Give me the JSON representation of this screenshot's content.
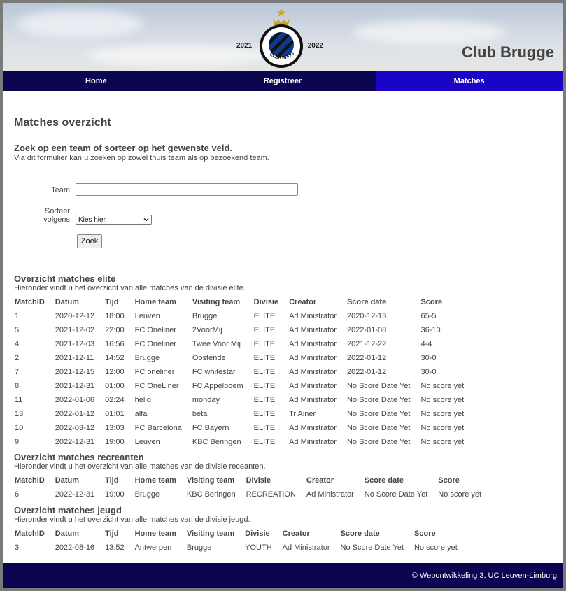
{
  "header": {
    "year_left": "2021",
    "year_right": "2022",
    "site_title": "Club Brugge",
    "logo_text": "CLUB BRUGGE K.V."
  },
  "nav": {
    "home": "Home",
    "register": "Registreer",
    "matches": "Matches"
  },
  "page": {
    "title": "Matches overzicht",
    "search_title": "Zoek op een team of sorteer op het gewenste veld.",
    "search_subtitle": "Via dit formulier kan u zoeken op zowel thuis team als op bezoekend team."
  },
  "form": {
    "team_label": "Team",
    "team_value": "",
    "sort_label_line1": "Sorteer",
    "sort_label_line2": "volgens",
    "sort_selected": "Kies hier",
    "submit_label": "Zoek"
  },
  "columns": [
    "MatchID",
    "Datum",
    "Tijd",
    "Home team",
    "Visiting team",
    "Divisie",
    "Creator",
    "Score date",
    "Score"
  ],
  "sections": {
    "elite": {
      "title": "Overzicht matches elite",
      "subtitle": "Hieronder vindt u het overzicht van alle matches van de divisie elite.",
      "rows": [
        [
          "1",
          "2020-12-12",
          "18:00",
          "Leuven",
          "Brugge",
          "ELITE",
          "Ad Ministrator",
          "2020-12-13",
          "65-5"
        ],
        [
          "5",
          "2021-12-02",
          "22:00",
          "FC Oneliner",
          "2VoorMij",
          "ELITE",
          "Ad Ministrator",
          "2022-01-08",
          "36-10"
        ],
        [
          "4",
          "2021-12-03",
          "16:56",
          "FC Oneliner",
          "Twee Voor Mij",
          "ELITE",
          "Ad Ministrator",
          "2021-12-22",
          "4-4"
        ],
        [
          "2",
          "2021-12-11",
          "14:52",
          "Brugge",
          "Oostende",
          "ELITE",
          "Ad Ministrator",
          "2022-01-12",
          "30-0"
        ],
        [
          "7",
          "2021-12-15",
          "12:00",
          "FC oneliner",
          "FC whitestar",
          "ELITE",
          "Ad Ministrator",
          "2022-01-12",
          "30-0"
        ],
        [
          "8",
          "2021-12-31",
          "01:00",
          "FC OneLiner",
          "FC Appelboem",
          "ELITE",
          "Ad Ministrator",
          "No Score Date Yet",
          "No score yet"
        ],
        [
          "11",
          "2022-01-06",
          "02:24",
          "hello",
          "monday",
          "ELITE",
          "Ad Ministrator",
          "No Score Date Yet",
          "No score yet"
        ],
        [
          "13",
          "2022-01-12",
          "01:01",
          "alfa",
          "beta",
          "ELITE",
          "Tr Ainer",
          "No Score Date Yet",
          "No score yet"
        ],
        [
          "10",
          "2022-03-12",
          "13:03",
          "FC Barcelona",
          "FC Bayern",
          "ELITE",
          "Ad Ministrator",
          "No Score Date Yet",
          "No score yet"
        ],
        [
          "9",
          "2022-12-31",
          "19:00",
          "Leuven",
          "KBC Beringen",
          "ELITE",
          "Ad Ministrator",
          "No Score Date Yet",
          "No score yet"
        ]
      ]
    },
    "recreanten": {
      "title": "Overzicht matches recreanten",
      "subtitle": "Hieronder vindt u het overzicht van alle matches van de divisie receanten.",
      "rows": [
        [
          "6",
          "2022-12-31",
          "19:00",
          "Brugge",
          "KBC Beringen",
          "RECREATION",
          "Ad Ministrator",
          "No Score Date Yet",
          "No score yet"
        ]
      ]
    },
    "jeugd": {
      "title": "Overzicht matches jeugd",
      "subtitle": "Hieronder vindt u het overzicht van alle matches van de divisie jeugd.",
      "rows": [
        [
          "3",
          "2022-08-16",
          "13:52",
          "Antwerpen",
          "Brugge",
          "YOUTH",
          "Ad Ministrator",
          "No Score Date Yet",
          "No score yet"
        ]
      ]
    }
  },
  "footer": {
    "text": "© Webontwikkeling 3, UC Leuven-Limburg"
  },
  "colors": {
    "nav_bg": "#0c0552",
    "nav_active": "#1a05c7",
    "logo_blue": "#0a3a8c",
    "gold": "#c9a227"
  }
}
